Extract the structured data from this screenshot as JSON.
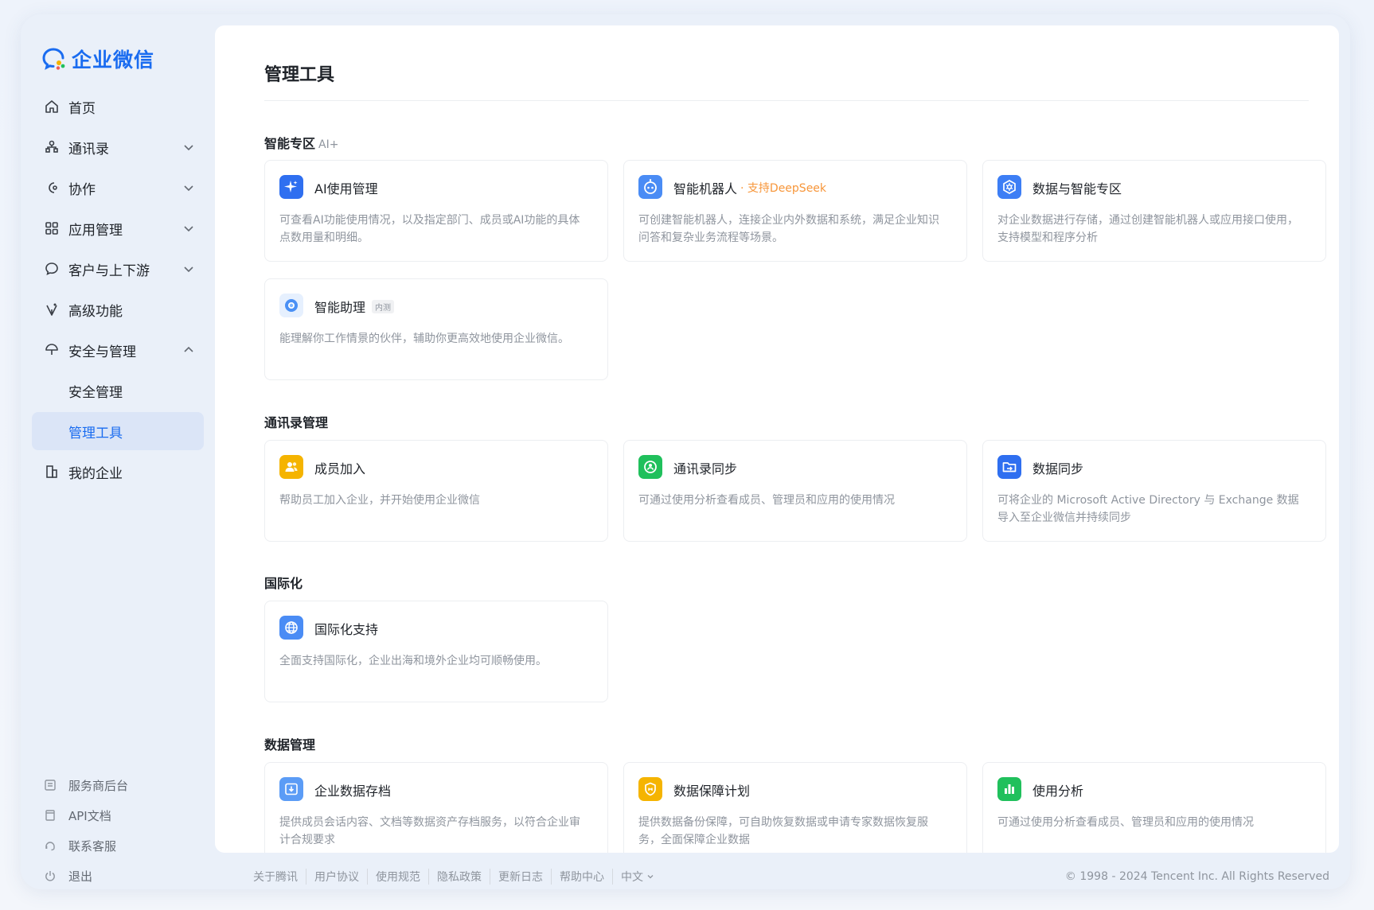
{
  "app": {
    "logo_text": "企业微信"
  },
  "sidebar": {
    "items": [
      {
        "label": "首页"
      },
      {
        "label": "通讯录"
      },
      {
        "label": "协作"
      },
      {
        "label": "应用管理"
      },
      {
        "label": "客户与上下游"
      },
      {
        "label": "高级功能"
      },
      {
        "label": "安全与管理"
      },
      {
        "label": "安全管理"
      },
      {
        "label": "管理工具"
      },
      {
        "label": "我的企业"
      }
    ],
    "bottom": [
      {
        "label": "服务商后台"
      },
      {
        "label": "API文档"
      },
      {
        "label": "联系客服"
      },
      {
        "label": "退出"
      }
    ]
  },
  "main": {
    "title": "管理工具",
    "sections": [
      {
        "title": "智能专区",
        "tag": "AI+",
        "cards": [
          {
            "title": "AI使用管理",
            "desc": "可查看AI功能使用情况，以及指定部门、成员或AI功能的具体点数用量和明细。"
          },
          {
            "title": "智能机器人",
            "badge": "· 支持DeepSeek",
            "desc": "可创建智能机器人，连接企业内外数据和系统，满足企业知识问答和复杂业务流程等场景。"
          },
          {
            "title": "数据与智能专区",
            "desc": "对企业数据进行存储，通过创建智能机器人或应用接口使用，支持模型和程序分析"
          },
          {
            "title": "智能助理",
            "badge": "内测",
            "desc": "能理解你工作情景的伙伴，辅助你更高效地使用企业微信。"
          }
        ]
      },
      {
        "title": "通讯录管理",
        "cards": [
          {
            "title": "成员加入",
            "desc": "帮助员工加入企业，并开始使用企业微信"
          },
          {
            "title": "通讯录同步",
            "desc": "可通过使用分析查看成员、管理员和应用的使用情况"
          },
          {
            "title": "数据同步",
            "desc": "可将企业的 Microsoft Active Directory 与 Exchange 数据导入至企业微信并持续同步"
          }
        ]
      },
      {
        "title": "国际化",
        "cards": [
          {
            "title": "国际化支持",
            "desc": "全面支持国际化，企业出海和境外企业均可顺畅使用。"
          }
        ]
      },
      {
        "title": "数据管理",
        "cards": [
          {
            "title": "企业数据存档",
            "desc": "提供成员会话内容、文档等数据资产存档服务，以符合企业审计合规要求"
          },
          {
            "title": "数据保障计划",
            "desc": "提供数据备份保障，可自助恢复数据或申请专家数据恢复服务，全面保障企业数据"
          },
          {
            "title": "使用分析",
            "desc": "可通过使用分析查看成员、管理员和应用的使用情况"
          }
        ]
      }
    ]
  },
  "footer": {
    "links": [
      "关于腾讯",
      "用户协议",
      "使用规范",
      "隐私政策",
      "更新日志",
      "帮助中心",
      "中文"
    ],
    "copyright": "© 1998 - 2024 Tencent Inc. All Rights Reserved"
  },
  "colors": {
    "brand": "#1a6cf0",
    "active_bg": "#dbe5f7",
    "orange": "#f7963a",
    "green": "#20c05c",
    "yellow": "#f5b400"
  }
}
